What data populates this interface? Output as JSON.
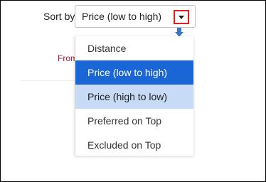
{
  "sort": {
    "label": "Sort by",
    "value": "Price (low to high)",
    "options": [
      {
        "label": "Distance",
        "state": "normal"
      },
      {
        "label": "Price (low to high)",
        "state": "selected"
      },
      {
        "label": "Price (high to low)",
        "state": "hover"
      },
      {
        "label": "Preferred on Top",
        "state": "normal"
      },
      {
        "label": "Excluded on Top",
        "state": "normal"
      }
    ]
  },
  "background": {
    "from_text": "From"
  },
  "colors": {
    "selected_bg": "#1a66d6",
    "hover_bg": "#c7dbf6",
    "highlight_border": "#e02020",
    "from_text": "#b3122b"
  },
  "icons": {
    "dropdown_caret": "chevron-down-icon",
    "pointer_arrow": "arrow-down-icon"
  }
}
